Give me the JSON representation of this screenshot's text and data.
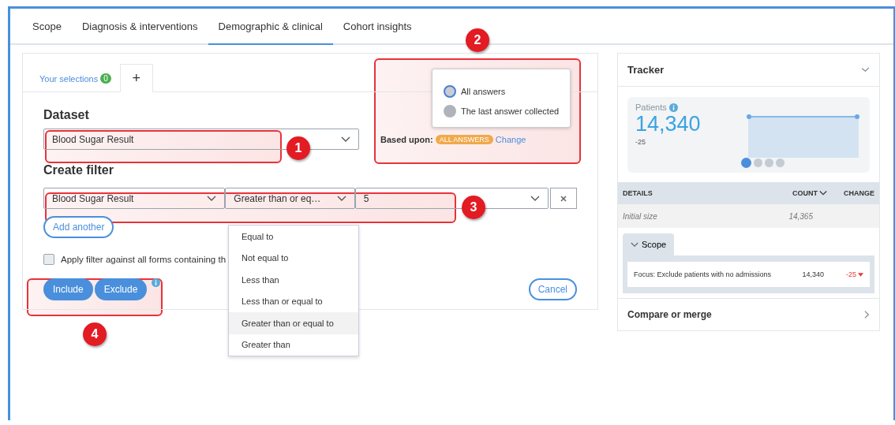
{
  "tabs": [
    {
      "label": "Scope",
      "selected": false
    },
    {
      "label": "Diagnosis & interventions",
      "selected": false
    },
    {
      "label": "Demographic & clinical",
      "selected": true
    },
    {
      "label": "Cohort insights",
      "selected": false
    }
  ],
  "selection_tabs": [
    {
      "label": "Your selections",
      "badge": "0",
      "selected": false
    },
    {
      "label": "+",
      "selected": true
    }
  ],
  "dataset": {
    "heading": "Dataset",
    "value": "Blood Sugar Result"
  },
  "based_upon": {
    "label": "Based upon:",
    "badge": "ALL ANSWERS",
    "link": "Change"
  },
  "answer_options": [
    {
      "label": "All answers",
      "selected": true
    },
    {
      "label": "The last answer collected",
      "selected": false
    }
  ],
  "filter": {
    "heading": "Create filter",
    "field": "Blood Sugar Result",
    "operator": "Greater than or eq…",
    "value": "5",
    "operators": [
      {
        "label": "Equal to",
        "selected": false
      },
      {
        "label": "Not equal to",
        "selected": false
      },
      {
        "label": "Less than",
        "selected": false
      },
      {
        "label": "Less than or equal to",
        "selected": false
      },
      {
        "label": "Greater than or equal to",
        "selected": true
      },
      {
        "label": "Greater than",
        "selected": false
      }
    ]
  },
  "add_another": "Add another",
  "apply_all": {
    "label": "Apply filter against all forms containing th",
    "checked": false
  },
  "actions": [
    "Include",
    "Exclude"
  ],
  "cancel": "Cancel",
  "callouts": [
    "1",
    "2",
    "3",
    "4"
  ],
  "tracker": {
    "title": "Tracker",
    "stat_label": "Patients",
    "stat_value": "14,340",
    "stat_change": "-25",
    "pages": [
      {
        "selected": true
      },
      {
        "selected": false
      },
      {
        "selected": false
      },
      {
        "selected": false
      }
    ],
    "columns": [
      "DETAILS",
      "COUNT",
      "CHANGE"
    ],
    "initial": {
      "label": "Initial size",
      "count": "14,365"
    },
    "groups": [
      {
        "title": "Scope",
        "expanded": true,
        "rows": [
          {
            "label": "Focus: Exclude patients with no admissions",
            "count": "14,340",
            "change": "-25"
          }
        ]
      }
    ],
    "compare": "Compare or merge"
  }
}
